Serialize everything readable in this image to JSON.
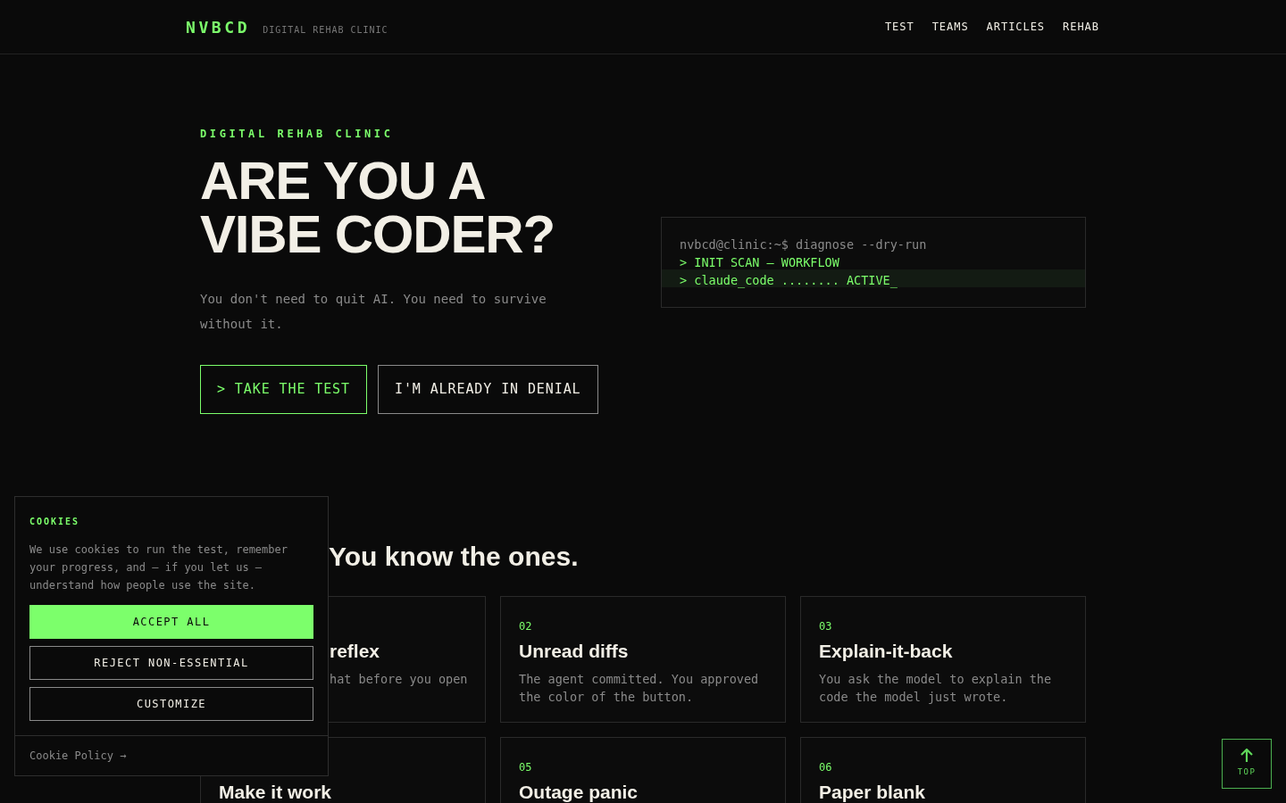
{
  "header": {
    "logo": "NVBCD",
    "tagline": "DIGITAL REHAB CLINIC",
    "nav": [
      "TEST",
      "TEAMS",
      "ARTICLES",
      "REHAB"
    ]
  },
  "hero": {
    "eyebrow": "DIGITAL REHAB CLINIC",
    "title_lines": [
      "ARE YOU A",
      "VIBE CODER?"
    ],
    "lead": "You don't need to quit AI. You need to survive without it.",
    "buttons": [
      {
        "label": "> TAKE THE TEST",
        "kind": "primary"
      },
      {
        "label": "I'M ALREADY IN DENIAL",
        "kind": "secondary"
      }
    ]
  },
  "terminal": {
    "lines": [
      {
        "text": "nvbcd@clinic:~$ diagnose --dry-run",
        "kind": "prompt"
      },
      {
        "text": "> INIT SCAN — WORKFLOW",
        "kind": "output"
      },
      {
        "text": "> claude_code ........ ACTIVE_",
        "kind": "output"
      }
    ]
  },
  "section": {
    "heading": "You know the ones.",
    "cards": [
      {
        "title": "reflex",
        "body": "hat before you open",
        "covered": true
      },
      {
        "number": "02",
        "title": "Unread diffs",
        "body": "The agent committed. You approved the color of the button.",
        "covered": false
      },
      {
        "number": "03",
        "title": "Explain-it-back",
        "body": "You ask the model to explain the code the model just wrote.",
        "covered": false
      },
      {
        "title": "Make it work",
        "covered": false
      },
      {
        "number": "05",
        "title": "Outage panic",
        "covered": false
      },
      {
        "number": "06",
        "title": "Paper blank",
        "covered": false
      }
    ]
  },
  "cookie_banner": {
    "title": "COOKIES",
    "text": "We use cookies to run the test, remember your progress, and — if you let us — understand how people use the site.",
    "buttons": [
      {
        "label": "ACCEPT ALL",
        "kind": "primary"
      },
      {
        "label": "REJECT NON-ESSENTIAL",
        "kind": "outline"
      },
      {
        "label": "CUSTOMIZE",
        "kind": "outline"
      }
    ],
    "policy_link": "Cookie Policy →"
  },
  "back_to_top": {
    "label": "TOP"
  }
}
